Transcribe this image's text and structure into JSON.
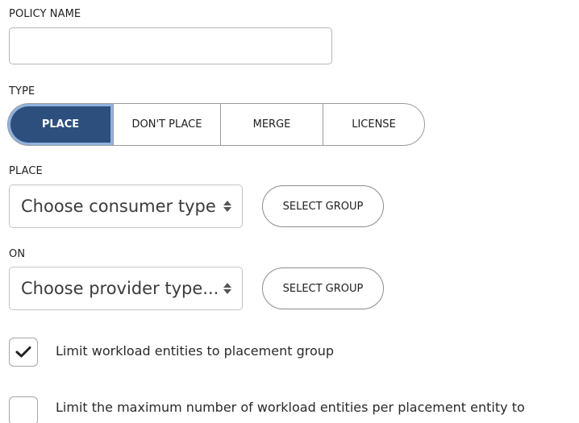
{
  "policy_name": {
    "label": "POLICY NAME",
    "value": "",
    "placeholder": ""
  },
  "type": {
    "label": "TYPE",
    "options": [
      "PLACE",
      "DON'T PLACE",
      "MERGE",
      "LICENSE"
    ],
    "selected": "PLACE",
    "accent_color": "#2d4f7d"
  },
  "place": {
    "label": "PLACE",
    "select_value": "Choose consumer type..",
    "button_label": "SELECT GROUP"
  },
  "on": {
    "label": "ON",
    "select_value": "Choose provider type...",
    "button_label": "SELECT GROUP"
  },
  "options": [
    {
      "label": "Limit workload entities to placement group",
      "checked": true
    },
    {
      "label": "Limit the maximum number of workload entities per placement entity to",
      "checked": false
    }
  ]
}
